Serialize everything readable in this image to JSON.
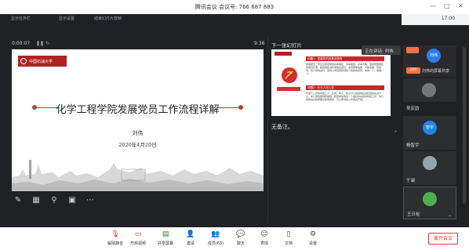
{
  "window": {
    "title": "腾讯会议 会议号: 766 687 883",
    "time": "17:00"
  },
  "ppt_toolbar": {
    "btn1": "显示任务栏",
    "btn2": "显示设置",
    "btn3": "结束幻灯片放映"
  },
  "presenter": {
    "elapsed": "0:00:07",
    "clock": "9:36",
    "next_label": "下一张幻灯片",
    "notes": "无备注。"
  },
  "slide": {
    "logo_text": "中国石油大学",
    "title": "化学工程学院发展党员工作流程详解",
    "author": "刘伟",
    "date": "2020年4月20日"
  },
  "next_slide": {
    "heading1": "问题1：发展党员的基本原则",
    "heading2": "问题2：什么人可入党",
    "body": "发展党员工作应当贯彻党的基本理论、基本路线、基本方略，坚持党章规定的党员标准，始终把政治标准放在首位；坚持慎重发展、均衡发展，有领导、有计划地进行；坚持入党自愿原则和个别吸收原则，成熟一个，发展一个。",
    "body2": "年满十八岁的中国工人、农民、军人、知识分子和其他社会阶层的先进分子，承认党的纲领和章程，愿意参加党的一个组织并在其中积极工作、执行党的决议和按期交纳党费的，可以申请加入中国共产党。"
  },
  "speaking": "正在讲话: 刘伟",
  "participants": [
    {
      "name": "刘伟",
      "card_label": "刘伟的屏幕共享",
      "avatar_color": "#2b7de9",
      "avatar_text": "刘伟"
    },
    {
      "name": "",
      "card_label": "",
      "avatar_color": "#777777"
    },
    {
      "name": "吴宏韵",
      "card_label": "",
      "avatar_color": "#444444"
    },
    {
      "name": "智宇",
      "card_label": "",
      "avatar_color": "#1e88e5",
      "avatar_text": "智宇"
    },
    {
      "name": "杨智宇",
      "card_label": "",
      "avatar_color": "#555555"
    },
    {
      "name": "于澜",
      "card_label": "",
      "avatar_color": "#90a4ae"
    },
    {
      "name": "王日祉",
      "card_label": "",
      "avatar_color": "#4caf50"
    }
  ],
  "toolbar": {
    "mute": "解除静音",
    "video": "开启视频",
    "share": "共享屏幕",
    "invite": "邀请",
    "members": "成员(63)",
    "chat": "聊天",
    "reactions": "表情",
    "docs": "文档",
    "settings": "设置",
    "leave": "离开会议"
  },
  "colors": {
    "accent": "#c0392b",
    "leave": "#e53935",
    "brand_blue": "#2b7de9"
  }
}
